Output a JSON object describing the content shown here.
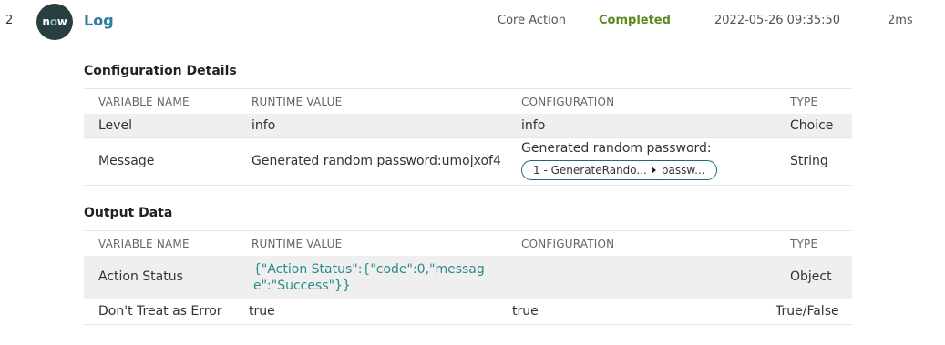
{
  "step": {
    "number": "2",
    "logo_text_pre": "n",
    "logo_text_o": "o",
    "logo_text_post": "w",
    "name": "Log",
    "type": "Core Action",
    "status": "Completed",
    "timestamp": "2022-05-26 09:35:50",
    "duration": "2ms"
  },
  "config": {
    "title": "Configuration Details",
    "headers": [
      "VARIABLE NAME",
      "RUNTIME VALUE",
      "CONFIGURATION",
      "TYPE"
    ],
    "rows": [
      {
        "name": "Level",
        "runtime": "info",
        "configuration": "info",
        "type": "Choice"
      },
      {
        "name": "Message",
        "runtime": "Generated random password:umojxof4",
        "configuration": "Generated random password:",
        "pill_left": "1 - GenerateRando...",
        "pill_right": "passw...",
        "type": "String"
      }
    ]
  },
  "output": {
    "title": "Output Data",
    "headers": [
      "VARIABLE NAME",
      "RUNTIME VALUE",
      "CONFIGURATION",
      "TYPE"
    ],
    "rows": [
      {
        "name": "Action Status",
        "runtime": "{\"Action Status\":{\"code\":0,\"message\":\"Success\"}}",
        "configuration": "",
        "type": "Object"
      },
      {
        "name": "Don't Treat as Error",
        "runtime": "true",
        "configuration": "true",
        "type": "True/False"
      }
    ]
  },
  "colors": {
    "accent": "#2e7d9a",
    "status_completed": "#5a8a1c",
    "json_value": "#2a8a86",
    "logo_bg": "#293e40"
  }
}
